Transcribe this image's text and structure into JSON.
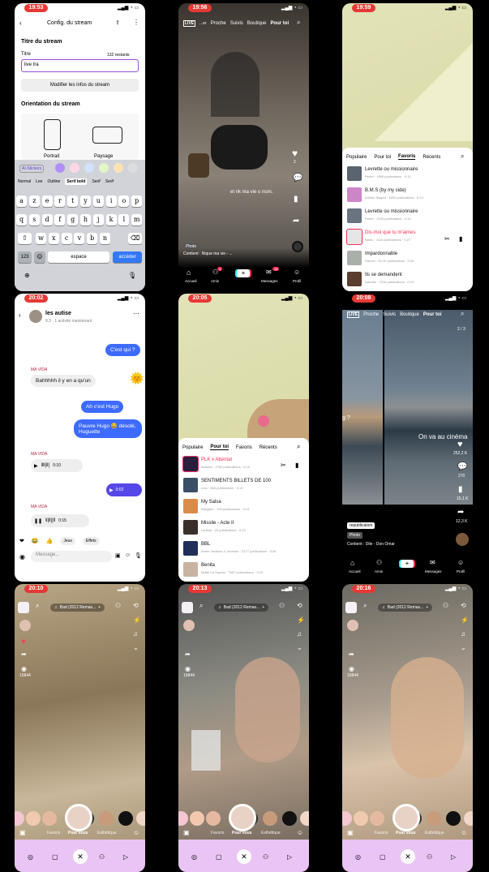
{
  "s1": {
    "time": "19:53",
    "title": "Config. du stream",
    "section": "Titre du stream",
    "label": "Titre",
    "count": "132 restants",
    "value": "live tra",
    "modify": "Modifier les infos du stream",
    "orient": "Orientation du stream",
    "portrait": "Portrait",
    "paysage": "Paysage",
    "ai": "AI-Stickers",
    "fonts": [
      "Normal",
      "Lee",
      "Outline",
      "Serif bold",
      "Serif",
      "Serif"
    ],
    "row1": [
      "a",
      "z",
      "e",
      "r",
      "t",
      "y",
      "u",
      "i",
      "o",
      "p"
    ],
    "row2": [
      "q",
      "s",
      "d",
      "f",
      "g",
      "h",
      "j",
      "k",
      "l",
      "m"
    ],
    "row3": [
      "w",
      "x",
      "c",
      "v",
      "b",
      "n"
    ],
    "k123": "123",
    "space": "espace",
    "go": "accéder"
  },
  "s2": {
    "time": "19:56",
    "tabs": [
      "LIVE",
      "...er",
      "Proche",
      "Suivis",
      "Boutique",
      "Pour toi"
    ],
    "caption": "et nk ma vie o nom.",
    "photo": "Photo",
    "sound": "Contient : Nique ma vie - ...",
    "nav": [
      "Accueil",
      "Amis",
      "",
      "Messages",
      "Profil"
    ],
    "badge1": "3",
    "badge2": "18",
    "likes": "2"
  },
  "s3": {
    "time": "19:59",
    "tabs": [
      "Populaire",
      "Pour toi",
      "Favoris",
      "Récents"
    ],
    "songs": [
      {
        "t": "Levrette ou missionnaire",
        "s": "Perrie · 1985 publications · 0:11"
      },
      {
        "t": "B.M.S (by my side)",
        "s": "Amiloo Stayed · 1832 publications · 0:14"
      },
      {
        "t": "Levrette ou missionnaire",
        "s": "Perrie · 2026 publications · 0:15"
      },
      {
        "t": "Dis-moi que tu m'aimes",
        "s": "Ninho · 4116 publications · 0:27"
      },
      {
        "t": "Impardonnable",
        "s": "Damso · 20,1K publications · 0:26"
      },
      {
        "t": "Ils se demandent",
        "s": "Dandan · 1916 publications · 0:15"
      }
    ]
  },
  "s4": {
    "time": "20:02",
    "name": "les autise",
    "sub": "8.3 · 1 activité maintenant",
    "msgs": [
      "C'est qui ?",
      "Bahhhhh il y en a qu'un",
      "Ah c'est Hugo",
      "Pauvre Hugo 😂 désolé, Huguette"
    ],
    "sender": "MA VIDA",
    "v1": "0:10",
    "v2": "0:02",
    "v3": "0:15",
    "input": "Message...",
    "chips": [
      "Jeux",
      "Effets"
    ]
  },
  "s5": {
    "time": "20:05",
    "tabs": [
      "Populaire",
      "Pour toi",
      "Favoris",
      "Récents"
    ],
    "songs": [
      {
        "t": "PLK x Attentat",
        "s": "Avkidzn · 2764 publications · 0:15"
      },
      {
        "t": "SENTIMENTS BILLETS DE 100",
        "s": "Leto · 884 publications · 0:15"
      },
      {
        "t": "My Salsa",
        "s": "Rangilch · 709 publications · 0:14"
      },
      {
        "t": "Missile - Acte II",
        "s": "Lartiste · 22 publications · 0:13"
      },
      {
        "t": "BBL",
        "s": "Amne Jackson & Johnnan · 2177 publications · 0:36"
      },
      {
        "t": "Benita",
        "s": "Mollie La Squate · 7667 publications · 1:00"
      }
    ]
  },
  "s6": {
    "time": "20:08",
    "tabs": [
      "LIVE",
      "Proche",
      "Suivis",
      "Boutique",
      "Pour toi"
    ],
    "page": "2 / 3",
    "caption": "On va au cinéma",
    "likes": "252,2 K",
    "comments": "270",
    "saves": "15,1 K",
    "shares": "12,3 K",
    "repub": "republication",
    "photo": "Photo",
    "sound": "Contient : Dile - Don Omar",
    "nav": [
      "Accueil",
      "Amis",
      "",
      "Messages",
      "Profil"
    ],
    "edge": "g ?"
  },
  "snap": {
    "times": [
      "20:10",
      "20:13",
      "20:16"
    ],
    "song": "Bad (2012 Remas...",
    "views": "15844",
    "tabs": [
      "Favoris",
      "Pour vous",
      "Esthétique"
    ]
  }
}
